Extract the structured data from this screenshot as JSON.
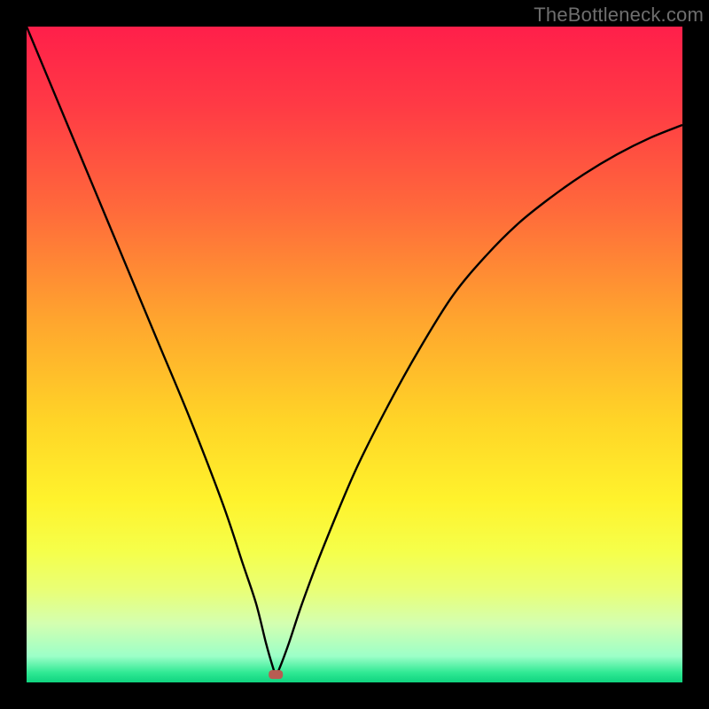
{
  "watermark": "TheBottleneck.com",
  "colors": {
    "background": "#000000",
    "curve": "#000000",
    "marker": "#b85c52",
    "gradient_stops": [
      {
        "offset": 0.0,
        "color": "#ff1f4a"
      },
      {
        "offset": 0.12,
        "color": "#ff3a45"
      },
      {
        "offset": 0.28,
        "color": "#ff6a3b"
      },
      {
        "offset": 0.45,
        "color": "#ffa62e"
      },
      {
        "offset": 0.6,
        "color": "#ffd427"
      },
      {
        "offset": 0.72,
        "color": "#fff22c"
      },
      {
        "offset": 0.8,
        "color": "#f5ff4a"
      },
      {
        "offset": 0.86,
        "color": "#e9ff77"
      },
      {
        "offset": 0.91,
        "color": "#d4ffb0"
      },
      {
        "offset": 0.96,
        "color": "#9cffc8"
      },
      {
        "offset": 0.985,
        "color": "#30e994"
      },
      {
        "offset": 1.0,
        "color": "#0fd47f"
      }
    ]
  },
  "chart_data": {
    "type": "line",
    "title": "",
    "xlabel": "",
    "ylabel": "",
    "xlim": [
      0,
      100
    ],
    "ylim": [
      0,
      100
    ],
    "legend": false,
    "grid": false,
    "marker": {
      "x": 38,
      "y": 1.2,
      "shape": "rounded-rect"
    },
    "series": [
      {
        "name": "bottleneck-curve",
        "x": [
          0,
          5,
          10,
          15,
          20,
          25,
          30,
          33,
          35,
          36.5,
          37.5,
          38,
          38.5,
          40,
          42,
          45,
          50,
          55,
          60,
          65,
          70,
          75,
          80,
          85,
          90,
          95,
          100
        ],
        "y": [
          100,
          88,
          76,
          64,
          52,
          40,
          27,
          18,
          12,
          6,
          2.5,
          1.2,
          2.0,
          6,
          12,
          20,
          32,
          42,
          51,
          59,
          65,
          70,
          74,
          77.5,
          80.5,
          83,
          85
        ]
      }
    ]
  }
}
